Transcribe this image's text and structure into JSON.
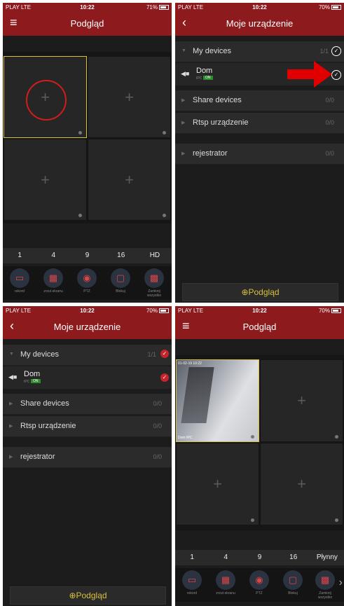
{
  "status": {
    "carrier": "PLAY",
    "network": "LTE",
    "time": "10:22"
  },
  "panels": {
    "p1": {
      "battery": "71%",
      "title": "Podgląd"
    },
    "p2": {
      "battery": "70%",
      "title": "Moje urządzenie"
    },
    "p3": {
      "battery": "70%",
      "title": "Moje urządzenie"
    },
    "p4": {
      "battery": "70%",
      "title": "Podgląd"
    }
  },
  "layout_tabs": {
    "t1": "1",
    "t4": "4",
    "t9": "9",
    "t16": "16",
    "hd": "HD",
    "smooth": "Płynny"
  },
  "tools": {
    "record": "rekord",
    "screenshot": "zrzut ekranu",
    "ptz": "PTZ",
    "block": "Blokuj",
    "close_all": "Zamknij wszystko"
  },
  "devices": {
    "my_devices": "My devices",
    "my_count": "1/1",
    "dom_name": "Dom",
    "dom_type": "IPC",
    "dom_status": "ON",
    "share": "Share devices",
    "share_count": "0/0",
    "rtsp": "Rtsp urządzenie",
    "rtsp_count": "0/0",
    "recorder": "rejestrator",
    "recorder_count": "0/0"
  },
  "preview_button": "⊕Podgląd",
  "video": {
    "osd": "01-02-19 10:22",
    "camera_name": "Dom IPC"
  },
  "colors": {
    "header": "#8d1a1d",
    "accent_yellow": "#d7c03c",
    "annotation_red": "#e00000"
  }
}
